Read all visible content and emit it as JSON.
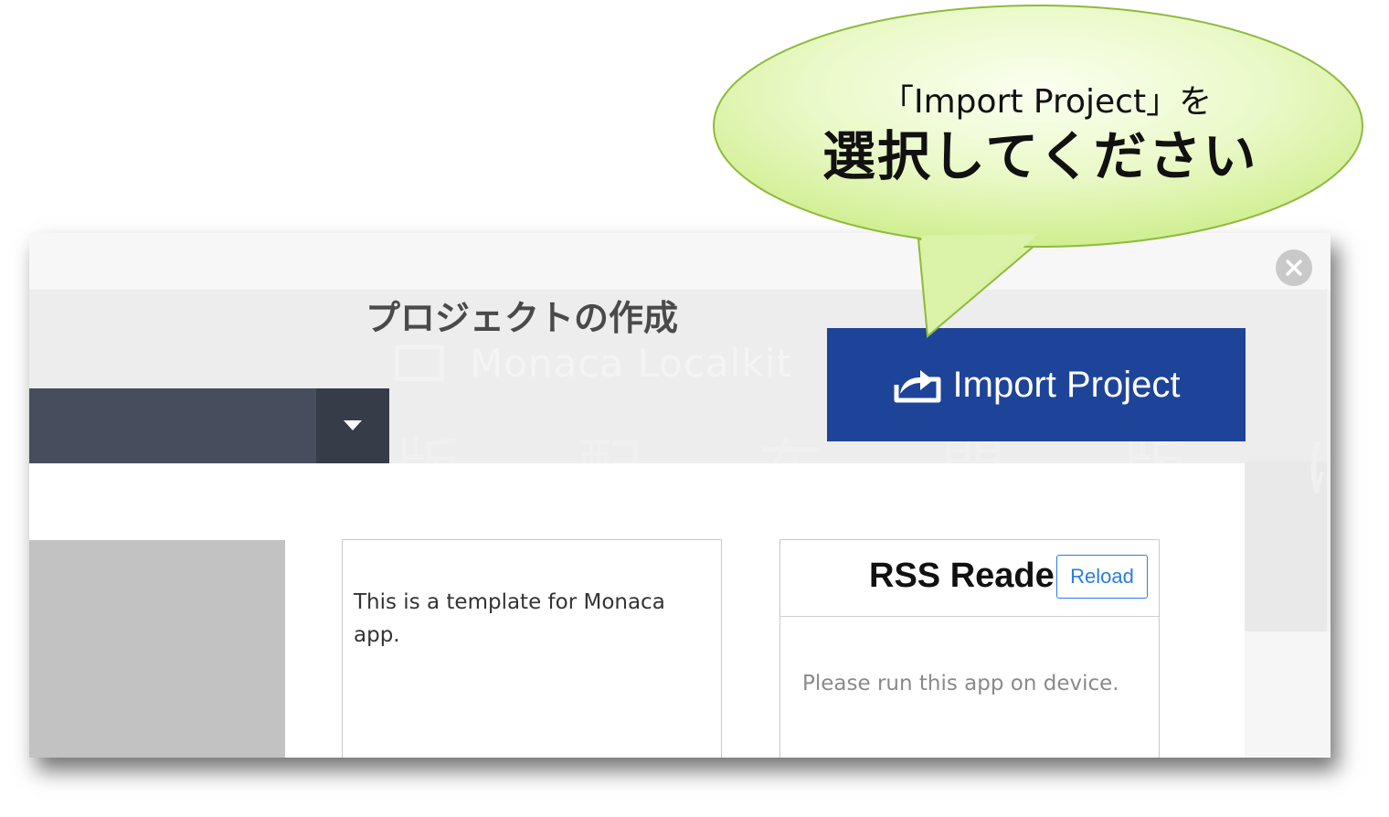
{
  "callout": {
    "line1": "「Import Project」を",
    "line2": "選択してください"
  },
  "dialog": {
    "title": "プロジェクトの作成",
    "import_button_label": "Import Project",
    "close_icon": "close-icon",
    "watermark": {
      "brand": "Monaca Localkit",
      "kanji": "版 配 布 開 版 け"
    },
    "template_card": {
      "description": "This is a template for Monaca app."
    },
    "rss_card": {
      "title": "RSS Reade",
      "reload_label": "Reload",
      "message": "Please run this app on device."
    }
  },
  "colors": {
    "import_button": "#1e449a",
    "select_bar": "#464d5c",
    "bubble_fill": "#dff5b4",
    "bubble_stroke": "#8fba3c",
    "reload_accent": "#2a7de1"
  }
}
